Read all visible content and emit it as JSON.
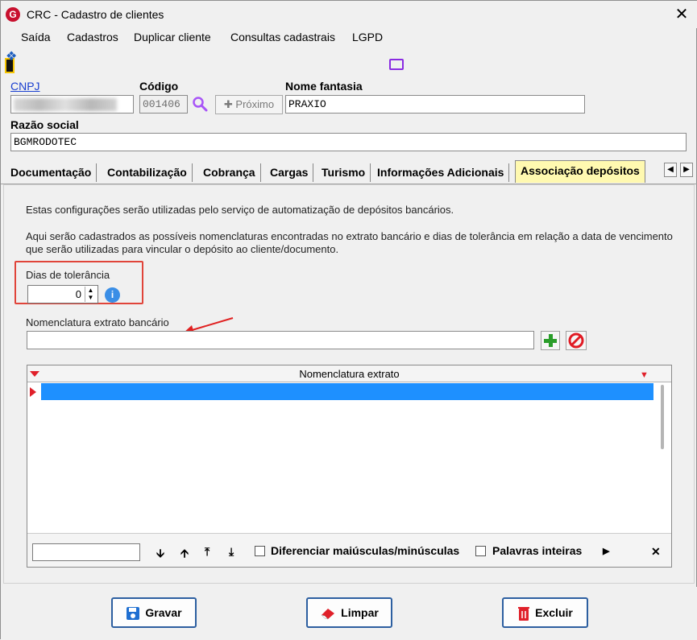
{
  "window": {
    "title": "CRC - Cadastro de clientes",
    "app_icon": "G",
    "close_glyph": "✕"
  },
  "menu": {
    "items": [
      "Saída",
      "Cadastros",
      "Duplicar cliente",
      "Consultas cadastrais",
      "LGPD"
    ]
  },
  "form": {
    "cnpj_label": "CNPJ",
    "codigo_label": "Código",
    "codigo_value": "001406",
    "proximo_label": "Próximo",
    "nome_fantasia_label": "Nome fantasia",
    "nome_fantasia_value": "PRAXIO",
    "razao_social_label": "Razão social",
    "razao_social_value": "BGMRODOTEC"
  },
  "tabs": [
    {
      "label": "Documentação"
    },
    {
      "label": "Contabilização"
    },
    {
      "label": "Cobrança"
    },
    {
      "label": "Cargas"
    },
    {
      "label": "Turismo"
    },
    {
      "label": "Informações Adicionais"
    },
    {
      "label": "Associação depósitos",
      "active": true
    }
  ],
  "panel": {
    "intro": "Estas configurações serão utilizadas pelo serviço de automatização de depósitos bancários.",
    "desc_line1": "Aqui serão cadastrados as possíveis nomenclaturas encontradas no extrato bancário e dias de tolerância em relação a data de vencimento",
    "desc_line2": "que serão utilizadas para vincular o depósito ao cliente/documento.",
    "dias_label": "Dias de tolerância",
    "dias_value": "0",
    "nomenclatura_label": "Nomenclatura extrato bancário",
    "nomenclatura_value": ""
  },
  "grid": {
    "header": "Nomenclatura extrato",
    "footer": {
      "diferenciar_label": "Diferenciar maiúsculas/minúsculas",
      "palavras_label": "Palavras inteiras",
      "diferenciar_checked": false,
      "palavras_checked": false
    }
  },
  "buttons": {
    "gravar": "Gravar",
    "limpar": "Limpar",
    "excluir": "Excluir"
  },
  "colors": {
    "accent_tab": "#fff9b0",
    "selection": "#1e90ff",
    "highlight_box": "#e0443a",
    "button_border": "#2d5fa0"
  }
}
